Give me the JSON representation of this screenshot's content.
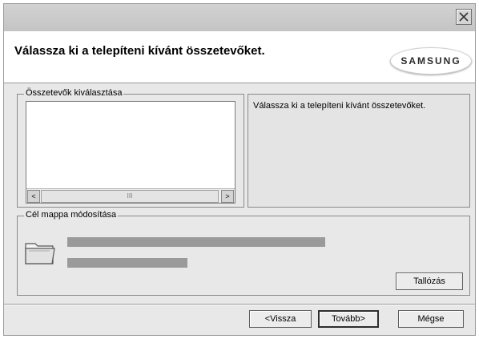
{
  "window": {
    "close_icon": "close-icon"
  },
  "header": {
    "title": "Válassza ki a telepíteni kívánt összetevőket.",
    "logo_text": "SAMSUNG"
  },
  "components": {
    "group_label": "Összetevők kiválasztása",
    "scroll_left": "<",
    "scroll_right": ">",
    "thumb_grip": "III",
    "description": "Válassza ki a telepíteni kívánt összetevőket."
  },
  "destination": {
    "group_label": "Cél mappa módosítása",
    "folder_icon": "folder-icon",
    "browse_label": "Tallózás"
  },
  "footer": {
    "back_label": "<Vissza",
    "next_label": "Tovább>",
    "cancel_label": "Mégse"
  }
}
